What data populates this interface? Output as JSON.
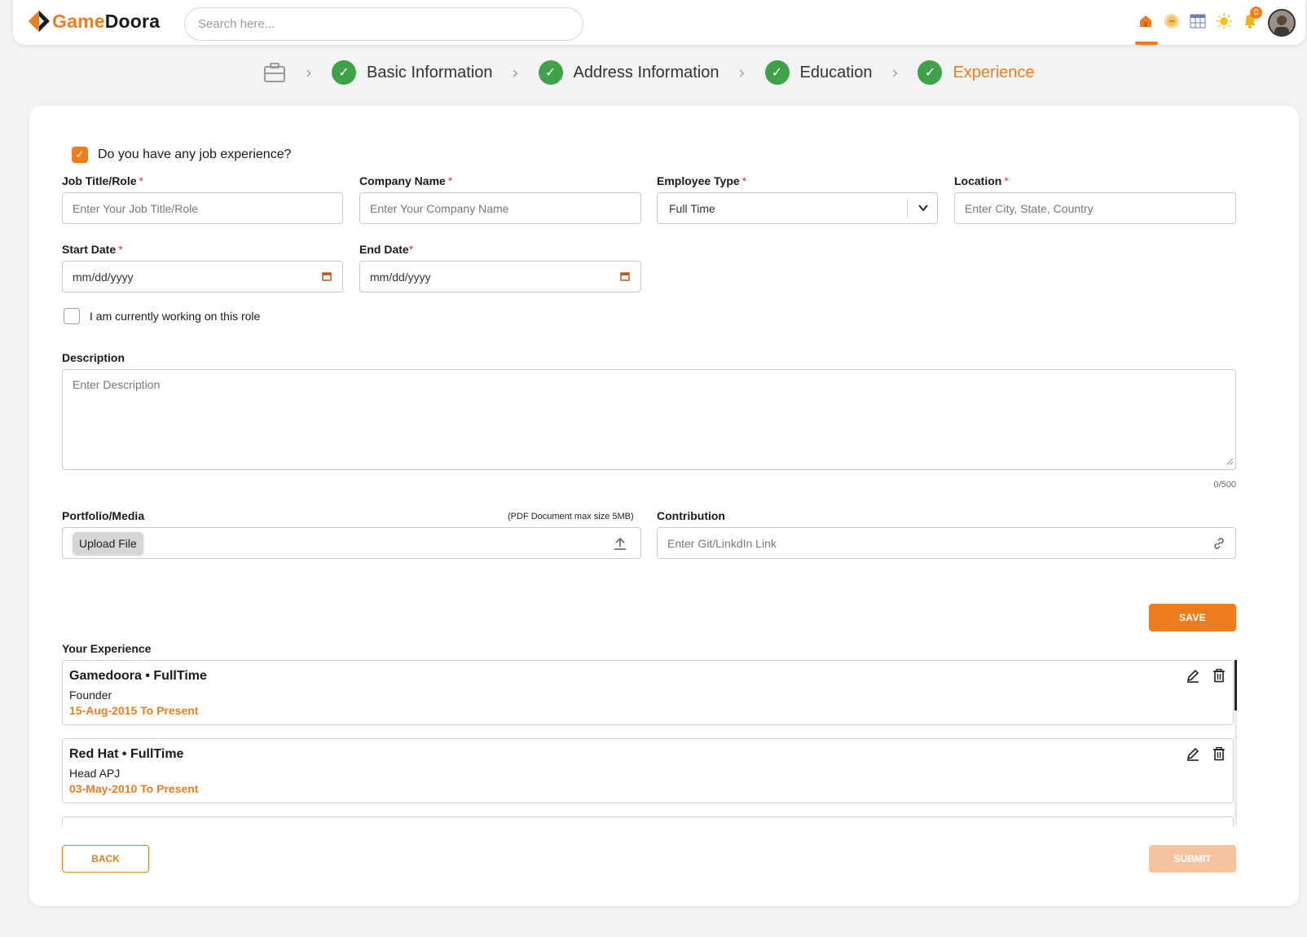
{
  "header": {
    "logo_prefix": "Game",
    "logo_suffix": "Doora",
    "search_placeholder": "Search here...",
    "notification_count": "0",
    "accent_color": "#ee7d1e"
  },
  "stepper": {
    "steps": [
      {
        "label": "Basic Information",
        "status": "complete"
      },
      {
        "label": "Address Information",
        "status": "complete"
      },
      {
        "label": "Education",
        "status": "complete"
      },
      {
        "label": "Experience",
        "status": "active"
      }
    ]
  },
  "form": {
    "experience_question": "Do you have any job experience?",
    "experience_checked": true,
    "job_title": {
      "label": "Job Title/Role",
      "placeholder": "Enter Your Job Title/Role"
    },
    "company_name": {
      "label": "Company Name",
      "placeholder": "Enter Your Company Name"
    },
    "employee_type": {
      "label": "Employee Type",
      "value": "Full Time"
    },
    "location": {
      "label": "Location",
      "placeholder": "Enter City, State, Country"
    },
    "start_date": {
      "label": "Start Date",
      "placeholder": "mm/dd/yyyy"
    },
    "end_date": {
      "label": "End Date",
      "placeholder": "mm/dd/yyyy"
    },
    "currently_working_label": "I am currently working on this role",
    "description": {
      "label": "Description",
      "placeholder": "Enter Description",
      "counter": "0/500"
    },
    "portfolio": {
      "label": "Portfolio/Media",
      "hint": "(PDF Document max size 5MB)",
      "upload_label": "Upload File"
    },
    "contribution": {
      "label": "Contribution",
      "placeholder": "Enter Git/LinkdIn Link"
    },
    "save_label": "SAVE"
  },
  "experience": {
    "heading": "Your Experience",
    "items": [
      {
        "title": "Gamedoora • FullTime",
        "role": "Founder",
        "dates": "15-Aug-2015 To Present"
      },
      {
        "title": "Red Hat • FullTime",
        "role": "Head APJ",
        "dates": "03-May-2010 To Present"
      }
    ]
  },
  "footer": {
    "back_label": "BACK",
    "submit_label": "SUBMIT"
  }
}
